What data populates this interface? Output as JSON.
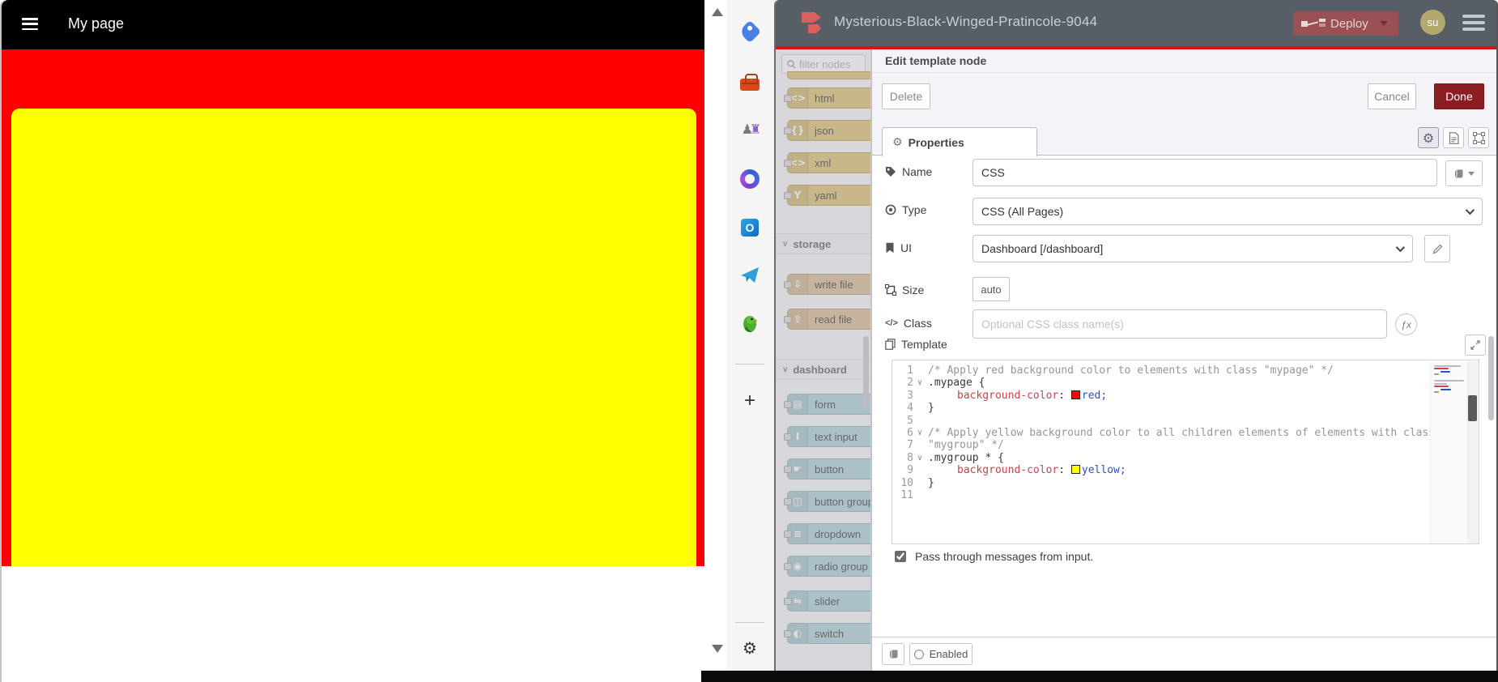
{
  "colors": {
    "accent_red": "#8C1E23",
    "page_red": "#FF0000",
    "page_yellow": "#FFFF00",
    "nr_header_bg": "#585E66",
    "deploy_bg": "#9A5156",
    "parser_node": "#DABD6B",
    "storage_node": "#D9B98C",
    "dashboard_node": "#A9CED2"
  },
  "preview": {
    "title": "My page"
  },
  "nr_header": {
    "title": "Mysterious-Black-Winged-Pratincole-9044",
    "deploy_label": "Deploy",
    "avatar_initials": "su"
  },
  "palette": {
    "filter_placeholder": "filter nodes",
    "parser_nodes": [
      {
        "label": "html",
        "glyph": "<>"
      },
      {
        "label": "json",
        "glyph": "{}"
      },
      {
        "label": "xml",
        "glyph": "<>"
      },
      {
        "label": "yaml",
        "glyph": "Y"
      }
    ],
    "storage_label": "storage",
    "storage_nodes": [
      {
        "label": "write file",
        "glyph": "⇩"
      },
      {
        "label": "read file",
        "glyph": "⇧"
      }
    ],
    "dashboard_label": "dashboard",
    "dashboard_nodes": [
      {
        "label": "form",
        "glyph": "▤"
      },
      {
        "label": "text input",
        "glyph": "I"
      },
      {
        "label": "button",
        "glyph": "☛"
      },
      {
        "label": "button group",
        "glyph": "◫"
      },
      {
        "label": "dropdown",
        "glyph": "≡"
      },
      {
        "label": "radio group",
        "glyph": "◉"
      },
      {
        "label": "slider",
        "glyph": "⇋"
      },
      {
        "label": "switch",
        "glyph": "◐"
      }
    ]
  },
  "dialog": {
    "title": "Edit template node",
    "delete_label": "Delete",
    "cancel_label": "Cancel",
    "done_label": "Done",
    "tab_properties": "Properties",
    "name_label": "Name",
    "name_value": "CSS",
    "type_label": "Type",
    "type_value": "CSS (All Pages)",
    "ui_label": "UI",
    "ui_value": "Dashboard [/dashboard]",
    "size_label": "Size",
    "size_value": "auto",
    "class_label": "Class",
    "class_placeholder": "Optional CSS class name(s)",
    "template_label": "Template",
    "passthrough_label": "Pass through messages from input.",
    "enabled_label": "Enabled"
  },
  "code": {
    "lines": [
      {
        "num": "1",
        "fold": "",
        "tokens": [
          {
            "c": "cmt",
            "t": "/* Apply red background color to elements with class \"mypage\" */"
          }
        ]
      },
      {
        "num": "2",
        "fold": "∨",
        "tokens": [
          {
            "c": "sel",
            "t": ".mypage"
          },
          {
            "c": "pln",
            "t": " {"
          }
        ]
      },
      {
        "num": "3",
        "fold": "",
        "tokens": [
          {
            "c": "ind",
            "t": ""
          },
          {
            "c": "prop",
            "t": "background-color"
          },
          {
            "c": "pln",
            "t": ": "
          },
          {
            "c": "swatch-red",
            "t": ""
          },
          {
            "c": "val",
            "t": "red;"
          }
        ]
      },
      {
        "num": "4",
        "fold": "",
        "tokens": [
          {
            "c": "pln",
            "t": "}"
          }
        ]
      },
      {
        "num": "5",
        "fold": "",
        "tokens": []
      },
      {
        "num": "6",
        "fold": "∨",
        "tokens": [
          {
            "c": "cmt",
            "t": "/* Apply yellow background color to all children elements of elements with class"
          }
        ]
      },
      {
        "num": "7",
        "fold": "",
        "tokens": [
          {
            "c": "cmt",
            "t": "\"mygroup\" */"
          }
        ]
      },
      {
        "num": "8",
        "fold": "∨",
        "tokens": [
          {
            "c": "sel",
            "t": ".mygroup *"
          },
          {
            "c": "pln",
            "t": " {"
          }
        ]
      },
      {
        "num": "9",
        "fold": "",
        "tokens": [
          {
            "c": "ind",
            "t": ""
          },
          {
            "c": "prop",
            "t": "background-color"
          },
          {
            "c": "pln",
            "t": ": "
          },
          {
            "c": "swatch-yellow",
            "t": ""
          },
          {
            "c": "val",
            "t": "yellow;"
          }
        ]
      },
      {
        "num": "10",
        "fold": "",
        "tokens": [
          {
            "c": "pln",
            "t": "}"
          }
        ]
      },
      {
        "num": "11",
        "fold": "",
        "tokens": []
      }
    ]
  }
}
